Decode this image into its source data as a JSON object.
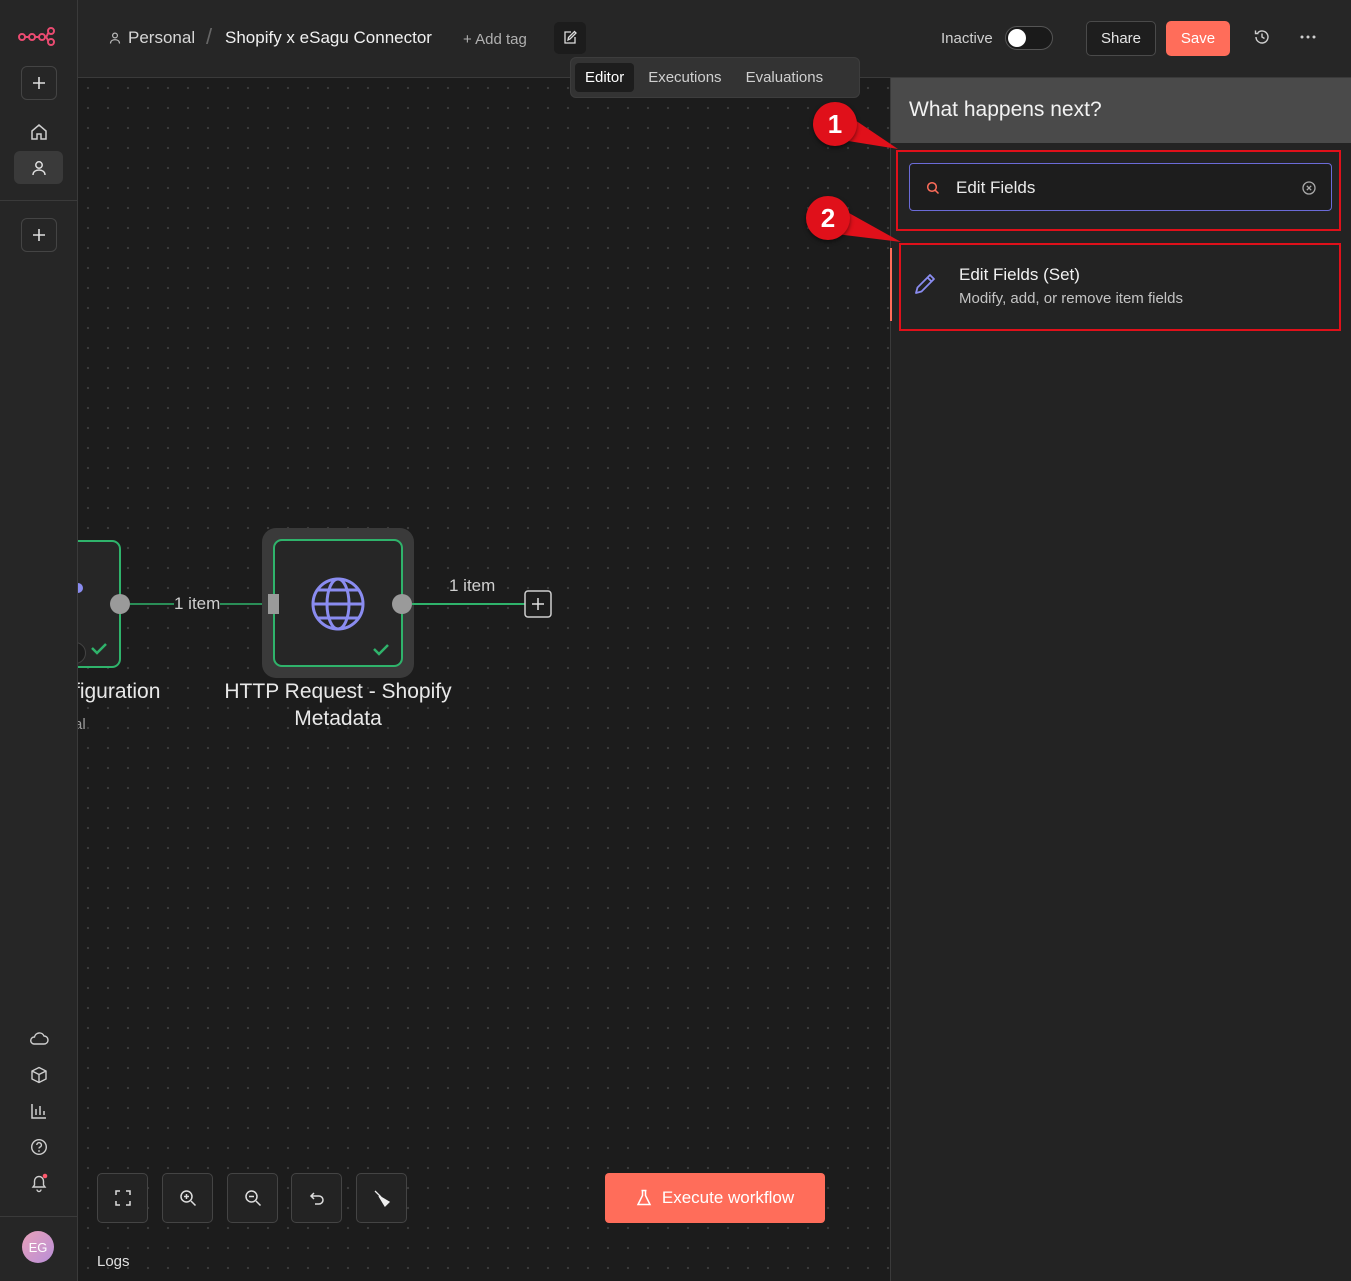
{
  "breadcrumb": {
    "project": "Personal",
    "workflow_name": "Shopify x eSagu  Connector",
    "add_tag": "+ Add tag"
  },
  "tabs": [
    "Editor",
    "Executions",
    "Evaluations"
  ],
  "header": {
    "status_label": "Inactive",
    "share_label": "Share",
    "save_label": "Save"
  },
  "canvas": {
    "left_node_label": "figuration",
    "left_node_sublabel": "al",
    "edge1_label": "1 item",
    "http_node_label_line1": "HTTP Request - Shopify",
    "http_node_label_line2": "Metadata",
    "edge2_label": "1 item",
    "execute_label": "Execute workflow",
    "logs_label": "Logs"
  },
  "panel": {
    "title": "What happens next?",
    "search_value": "Edit Fields",
    "result_title": "Edit Fields (Set)",
    "result_desc": "Modify, add, or remove item fields"
  },
  "annotations": [
    "1",
    "2"
  ],
  "user": {
    "initials": "EG"
  },
  "colors": {
    "accent": "#ff6d5a",
    "success": "#2fb36b",
    "node_icon": "#8a8cf0",
    "annotation": "#e0101a"
  }
}
